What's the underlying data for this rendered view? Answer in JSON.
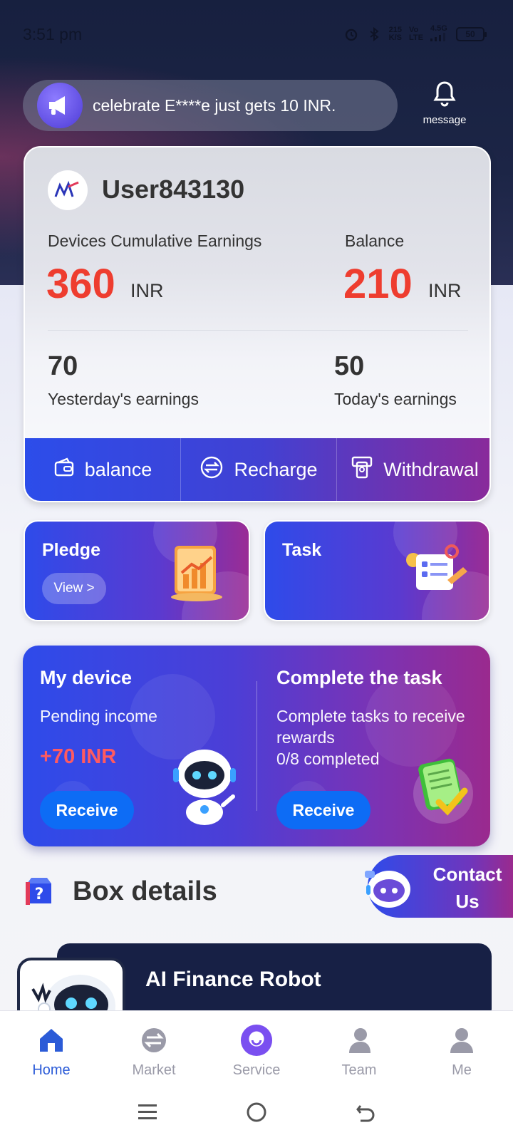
{
  "status_bar": {
    "time": "3:51 pm",
    "net_speed": "215",
    "net_speed_unit": "K/S",
    "volte_top": "Vo",
    "volte_bottom": "LTE",
    "network": "4.5G",
    "battery": "50"
  },
  "notice": {
    "text": "celebrate E****e just gets 10 INR."
  },
  "message_button": {
    "label": "message"
  },
  "user": {
    "name": "User843130",
    "cumulative_label": "Devices Cumulative Earnings",
    "cumulative_value": "360",
    "cumulative_unit": "INR",
    "balance_label": "Balance",
    "balance_value": "210",
    "balance_unit": "INR",
    "yesterday_value": "70",
    "yesterday_label": "Yesterday's earnings",
    "today_value": "50",
    "today_label": "Today's earnings"
  },
  "actions": {
    "balance": "balance",
    "recharge": "Recharge",
    "withdrawal": "Withdrawal"
  },
  "tiles": {
    "pledge_title": "Pledge",
    "pledge_view": "View >",
    "task_title": "Task"
  },
  "device": {
    "title": "My device",
    "pending_label": "Pending income",
    "amount": "+70 INR",
    "receive": "Receive",
    "task_title": "Complete the task",
    "task_desc": "Complete tasks to receive rewards",
    "task_progress": "0/8 completed",
    "task_receive": "Receive"
  },
  "box": {
    "title": "Box details"
  },
  "contact": {
    "label": "Contact Us"
  },
  "product": {
    "name": "AI Finance Robot"
  },
  "nav": {
    "home": "Home",
    "market": "Market",
    "service": "Service",
    "team": "Team",
    "me": "Me"
  },
  "colors": {
    "accent_blue": "#2e4bea",
    "accent_purple": "#9a2a8e",
    "amount_red": "#ee3d2f",
    "active_nav": "#2b5bd7"
  }
}
